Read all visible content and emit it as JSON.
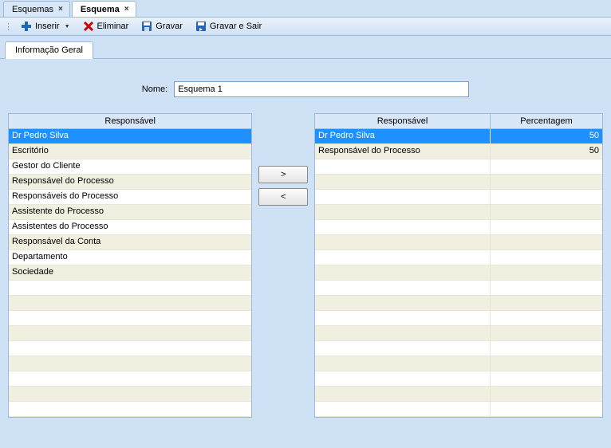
{
  "tabs": {
    "tab1": "Esquemas",
    "tab2": "Esquema"
  },
  "toolbar": {
    "insert": "Inserir",
    "delete": "Eliminar",
    "save": "Gravar",
    "saveExit": "Gravar e Sair"
  },
  "subTabs": {
    "general": "Informação Geral"
  },
  "form": {
    "nameLabel": "Nome:",
    "nameValue": "Esquema 1"
  },
  "leftList": {
    "header": "Responsável",
    "rows": [
      "Dr Pedro Silva",
      "Escritório",
      "Gestor do Cliente",
      "Responsável do Processo",
      "Responsáveis do Processo",
      "Assistente do Processo",
      "Assistentes do Processo",
      "Responsável da Conta",
      "Departamento",
      "Sociedade",
      "",
      "",
      "",
      "",
      "",
      "",
      "",
      "",
      ""
    ],
    "selectedIndex": 0
  },
  "rightList": {
    "header1": "Responsável",
    "header2": "Percentagem",
    "rows": [
      {
        "name": "Dr Pedro Silva",
        "pct": "50"
      },
      {
        "name": "Responsável do Processo",
        "pct": "50"
      },
      {
        "name": "",
        "pct": ""
      },
      {
        "name": "",
        "pct": ""
      },
      {
        "name": "",
        "pct": ""
      },
      {
        "name": "",
        "pct": ""
      },
      {
        "name": "",
        "pct": ""
      },
      {
        "name": "",
        "pct": ""
      },
      {
        "name": "",
        "pct": ""
      },
      {
        "name": "",
        "pct": ""
      },
      {
        "name": "",
        "pct": ""
      },
      {
        "name": "",
        "pct": ""
      },
      {
        "name": "",
        "pct": ""
      },
      {
        "name": "",
        "pct": ""
      },
      {
        "name": "",
        "pct": ""
      },
      {
        "name": "",
        "pct": ""
      },
      {
        "name": "",
        "pct": ""
      },
      {
        "name": "",
        "pct": ""
      },
      {
        "name": "",
        "pct": ""
      }
    ],
    "selectedIndex": 0
  },
  "buttons": {
    "add": ">",
    "remove": "<"
  }
}
